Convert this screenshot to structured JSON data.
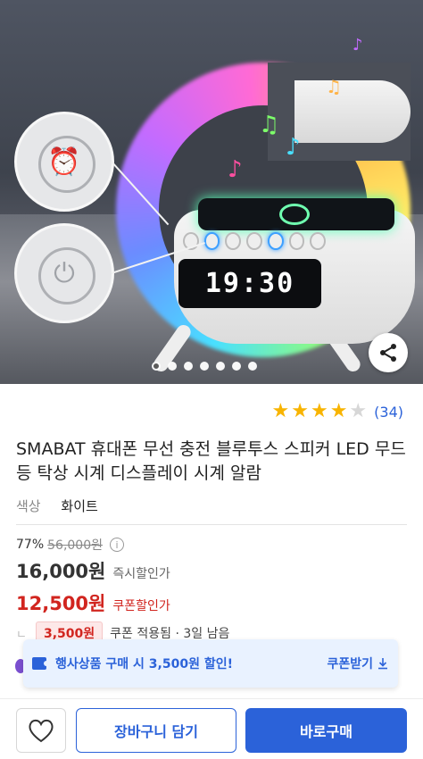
{
  "product": {
    "clock_display": "19:30",
    "image_dots": {
      "count": 7,
      "active_index": 0
    },
    "rating": {
      "stars": 4,
      "max": 5,
      "count_text": "(34)"
    },
    "title": "SMABAT 휴대폰 무선 충전 블루투스 스피커 LED 무드등 탁상 시계 디스플레이 시계 알람",
    "option": {
      "key": "색상",
      "value": "화이트"
    }
  },
  "price": {
    "discount_pct": "77%",
    "original": "56,000원",
    "instant_price": "16,000원",
    "instant_label": "즉시할인가",
    "coupon_price": "12,500원",
    "coupon_label": "쿠폰할인가",
    "coupon_amount": "3,500원",
    "coupon_note": "쿠폰 적용됨 · 3일 남음"
  },
  "banner": {
    "message": "행사상품 구매 시 3,500원 할인!",
    "action": "쿠폰받기"
  },
  "bottom_bar": {
    "cart_label": "장바구니 담기",
    "buy_label": "바로구매"
  },
  "colors": {
    "accent": "#2b62d9",
    "sale_red": "#d1251f",
    "star": "#f8b400"
  },
  "icons": [
    "alarm-clock-icon",
    "power-icon",
    "share-icon",
    "info-icon",
    "download-icon",
    "heart-icon",
    "coupon-icon",
    "star-icon"
  ]
}
